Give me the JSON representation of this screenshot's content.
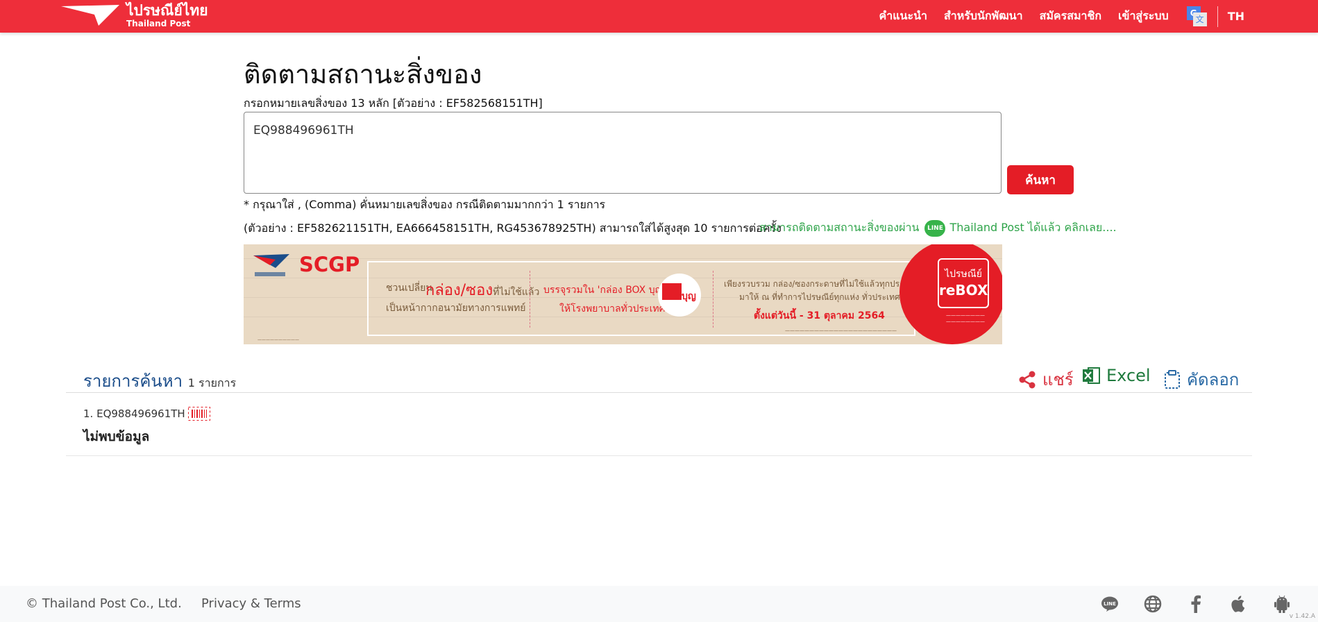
{
  "header": {
    "logo_th": "ไปรษณีย์ไทย",
    "logo_en": "Thailand Post",
    "nav": [
      "คำแนะนำ",
      "สำหรับนักพัฒนา",
      "สมัครสมาชิก",
      "เข้าสู่ระบบ"
    ],
    "translate_icon": "google-translate-icon",
    "lang": "TH"
  },
  "main": {
    "title": "ติดตามสถานะสิ่งของ",
    "hint": "กรอกหมายเลขสิ่งของ 13 หลัก [ตัวอย่าง : EF582568151TH]",
    "input_value": "EQ988496961TH",
    "search_label": "ค้นหา",
    "note1": "* กรุณาใส่ , (Comma) คั่นหมายเลขสิ่งของ กรณีติดตามมากกว่า 1 รายการ",
    "note2": "(ตัวอย่าง : EF582621151TH, EA666458151TH, RG453678925TH) สามารถใส่ได้สูงสุด 10 รายการต่อครั้ง",
    "line_prefix": "สามารถติดตามสถานะสิ่งของผ่าน",
    "line_badge": "LINE",
    "line_suffix": "Thailand Post ได้แล้ว คลิกเลย....",
    "brand_red": "#ee2e3a"
  },
  "banner": {
    "brand": "SCGP",
    "t1": "ชวนเปลี่ยน",
    "t1b": "กล่อง/ซอง",
    "t1c": "ที่ไม่ใช้แล้ว",
    "t2": "เป็นหน้ากากอนามัยทางการแพทย์",
    "t3": "บรรจุรวมใน 'กล่อง BOX บุญ'",
    "t4": "ให้โรงพยาบาลทั่วประเทศ",
    "box_label": "บุญ",
    "t5": "เพียงรวบรวม กล่อง/ซองกระดาษที่ไม่ใช้แล้วทุกประเภท",
    "t6": "มาให้ ณ ที่ทำการไปรษณีย์ทุกแห่ง ทั่วประเทศ*",
    "t7": "ตั้งแต่วันนี้ - 31 ตุลาคม 2564",
    "rebox_a": "ไปรษณีย์",
    "rebox_b": "reBOX"
  },
  "results": {
    "title": "รายการค้นหา",
    "count": "1 รายการ",
    "share_label": "แชร์",
    "excel_label": "Excel",
    "copy_label": "คัดลอก",
    "items": [
      {
        "index": "1.",
        "tracking": "EQ988496961TH",
        "status": "ไม่พบข้อมูล"
      }
    ]
  },
  "footer": {
    "copyright": "© Thailand Post Co., Ltd.",
    "privacy": "Privacy & Terms",
    "icons": [
      "line-icon",
      "globe-icon",
      "facebook-icon",
      "apple-icon",
      "android-icon"
    ],
    "version": "v 1.42.A"
  }
}
